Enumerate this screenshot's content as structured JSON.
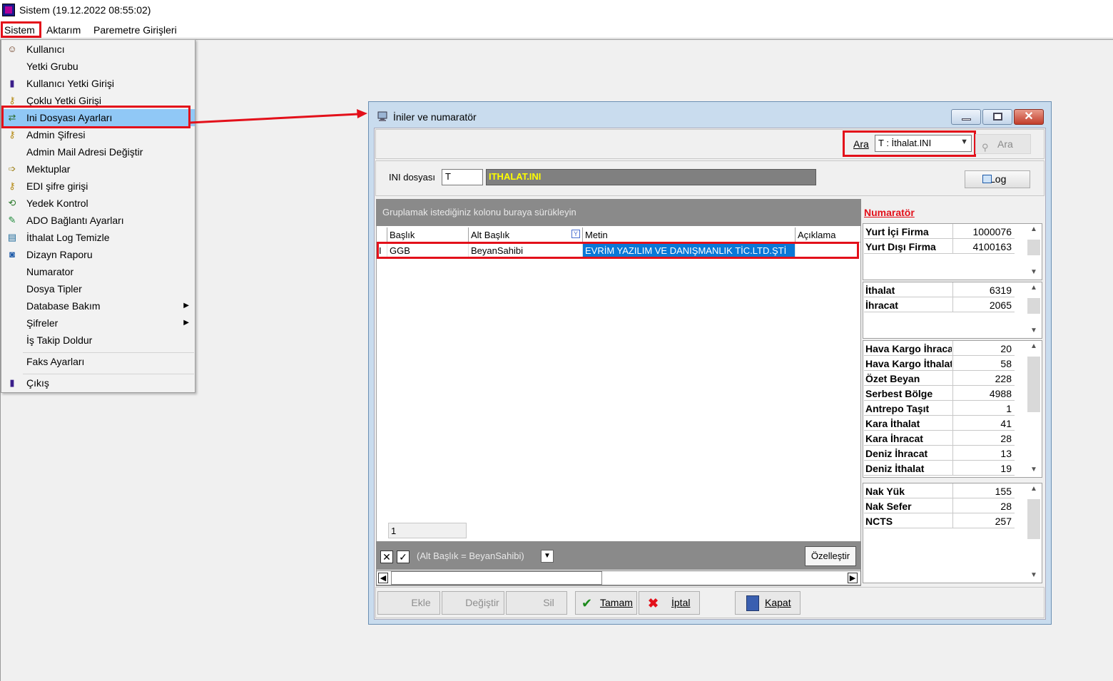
{
  "app": {
    "title": "Sistem (19.12.2022 08:55:02)"
  },
  "menubar": {
    "items": [
      "Sistem",
      "Aktarım",
      "Paremetre Girişleri"
    ]
  },
  "dropdown": {
    "items": [
      {
        "label": "Kullanıcı",
        "icon": "user-icon"
      },
      {
        "label": "Yetki Grubu",
        "icon": ""
      },
      {
        "label": "Kullanıcı Yetki Girişi",
        "icon": "door-icon"
      },
      {
        "label": "Çoklu Yetki Girişi",
        "icon": "key-icon"
      },
      {
        "label": "Ini Dosyası  Ayarları",
        "icon": "settings-file-icon"
      },
      {
        "label": "Admin Şifresi",
        "icon": "key-icon"
      },
      {
        "label": "Admin Mail Adresi Değiştir",
        "icon": ""
      },
      {
        "label": "Mektuplar",
        "icon": "mail-arrow-icon"
      },
      {
        "label": "EDI şifre girişi",
        "icon": "key-icon"
      },
      {
        "label": "Yedek Kontrol",
        "icon": "backup-icon"
      },
      {
        "label": "ADO Bağlantı Ayarları",
        "icon": "connection-icon"
      },
      {
        "label": "İthalat Log Temizle",
        "icon": "log-clean-icon"
      },
      {
        "label": "Dizayn Raporu",
        "icon": "report-icon"
      },
      {
        "label": "Numarator",
        "icon": ""
      },
      {
        "label": "Dosya Tipler",
        "icon": ""
      },
      {
        "label": "Database Bakım",
        "icon": "",
        "submenu": true
      },
      {
        "label": "Şifreler",
        "icon": "",
        "submenu": true
      },
      {
        "label": "İş Takip Doldur",
        "icon": ""
      },
      {
        "label": "Faks Ayarları",
        "icon": ""
      },
      {
        "label": "Çıkış",
        "icon": "exit-door-icon"
      }
    ],
    "selected_index": 4
  },
  "dialog": {
    "title": "İniler ve numaratör",
    "search": {
      "label": "Ara",
      "value": "T : İthalat.INI",
      "button": "Ara"
    },
    "ini": {
      "label": "INI dosyası",
      "input_value": "T",
      "file_name": "ITHALAT.INI",
      "log_button": "Log"
    },
    "grid": {
      "group_hint": "Gruplamak istediğiniz kolonu buraya sürükleyin",
      "columns": [
        "Başlık",
        "Alt Başlık",
        "Metin",
        "Açıklama"
      ],
      "rows": [
        {
          "indicator": "I",
          "baslik": "GGB",
          "alt_baslik": "BeyanSahibi",
          "metin": "EVRİM YAZILIM VE DANIŞMANLIK TİC.LTD.ŞTİ",
          "aciklama": ""
        }
      ],
      "record_count": "1",
      "filter_text": "(Alt Başlık = BeyanSahibi)",
      "customize_button": "Özelleştir"
    },
    "numerator": {
      "title": "Numaratör",
      "groups": [
        [
          {
            "name": "Yurt İçi Firma",
            "value": "1000076"
          },
          {
            "name": "Yurt Dışı Firma",
            "value": "4100163"
          }
        ],
        [
          {
            "name": "İthalat",
            "value": "6319"
          },
          {
            "name": "İhracat",
            "value": "2065"
          }
        ],
        [
          {
            "name": "Hava Kargo İhracat",
            "value": "20"
          },
          {
            "name": "Hava Kargo İthalat",
            "value": "58"
          },
          {
            "name": "Özet Beyan",
            "value": "228"
          },
          {
            "name": "Serbest Bölge",
            "value": "4988"
          },
          {
            "name": "Antrepo Taşıt",
            "value": "1"
          },
          {
            "name": "Kara İthalat",
            "value": "41"
          },
          {
            "name": "Kara İhracat",
            "value": "28"
          },
          {
            "name": "Deniz İhracat",
            "value": "13"
          },
          {
            "name": "Deniz İthalat",
            "value": "19"
          }
        ],
        [
          {
            "name": "Nak Yük",
            "value": "155"
          },
          {
            "name": "Nak Sefer",
            "value": "28"
          },
          {
            "name": "NCTS",
            "value": "257"
          }
        ]
      ]
    },
    "buttons": {
      "ekle": "Ekle",
      "degistir": "Değiştir",
      "sil": "Sil",
      "tamam": "Tamam",
      "iptal": "İptal",
      "kapat": "Kapat"
    }
  },
  "colors": {
    "highlight_red": "#e3101a",
    "menu_selected": "#90c8f6",
    "grid_selection": "#0a78d7",
    "ini_value_text": "#ffff00"
  }
}
